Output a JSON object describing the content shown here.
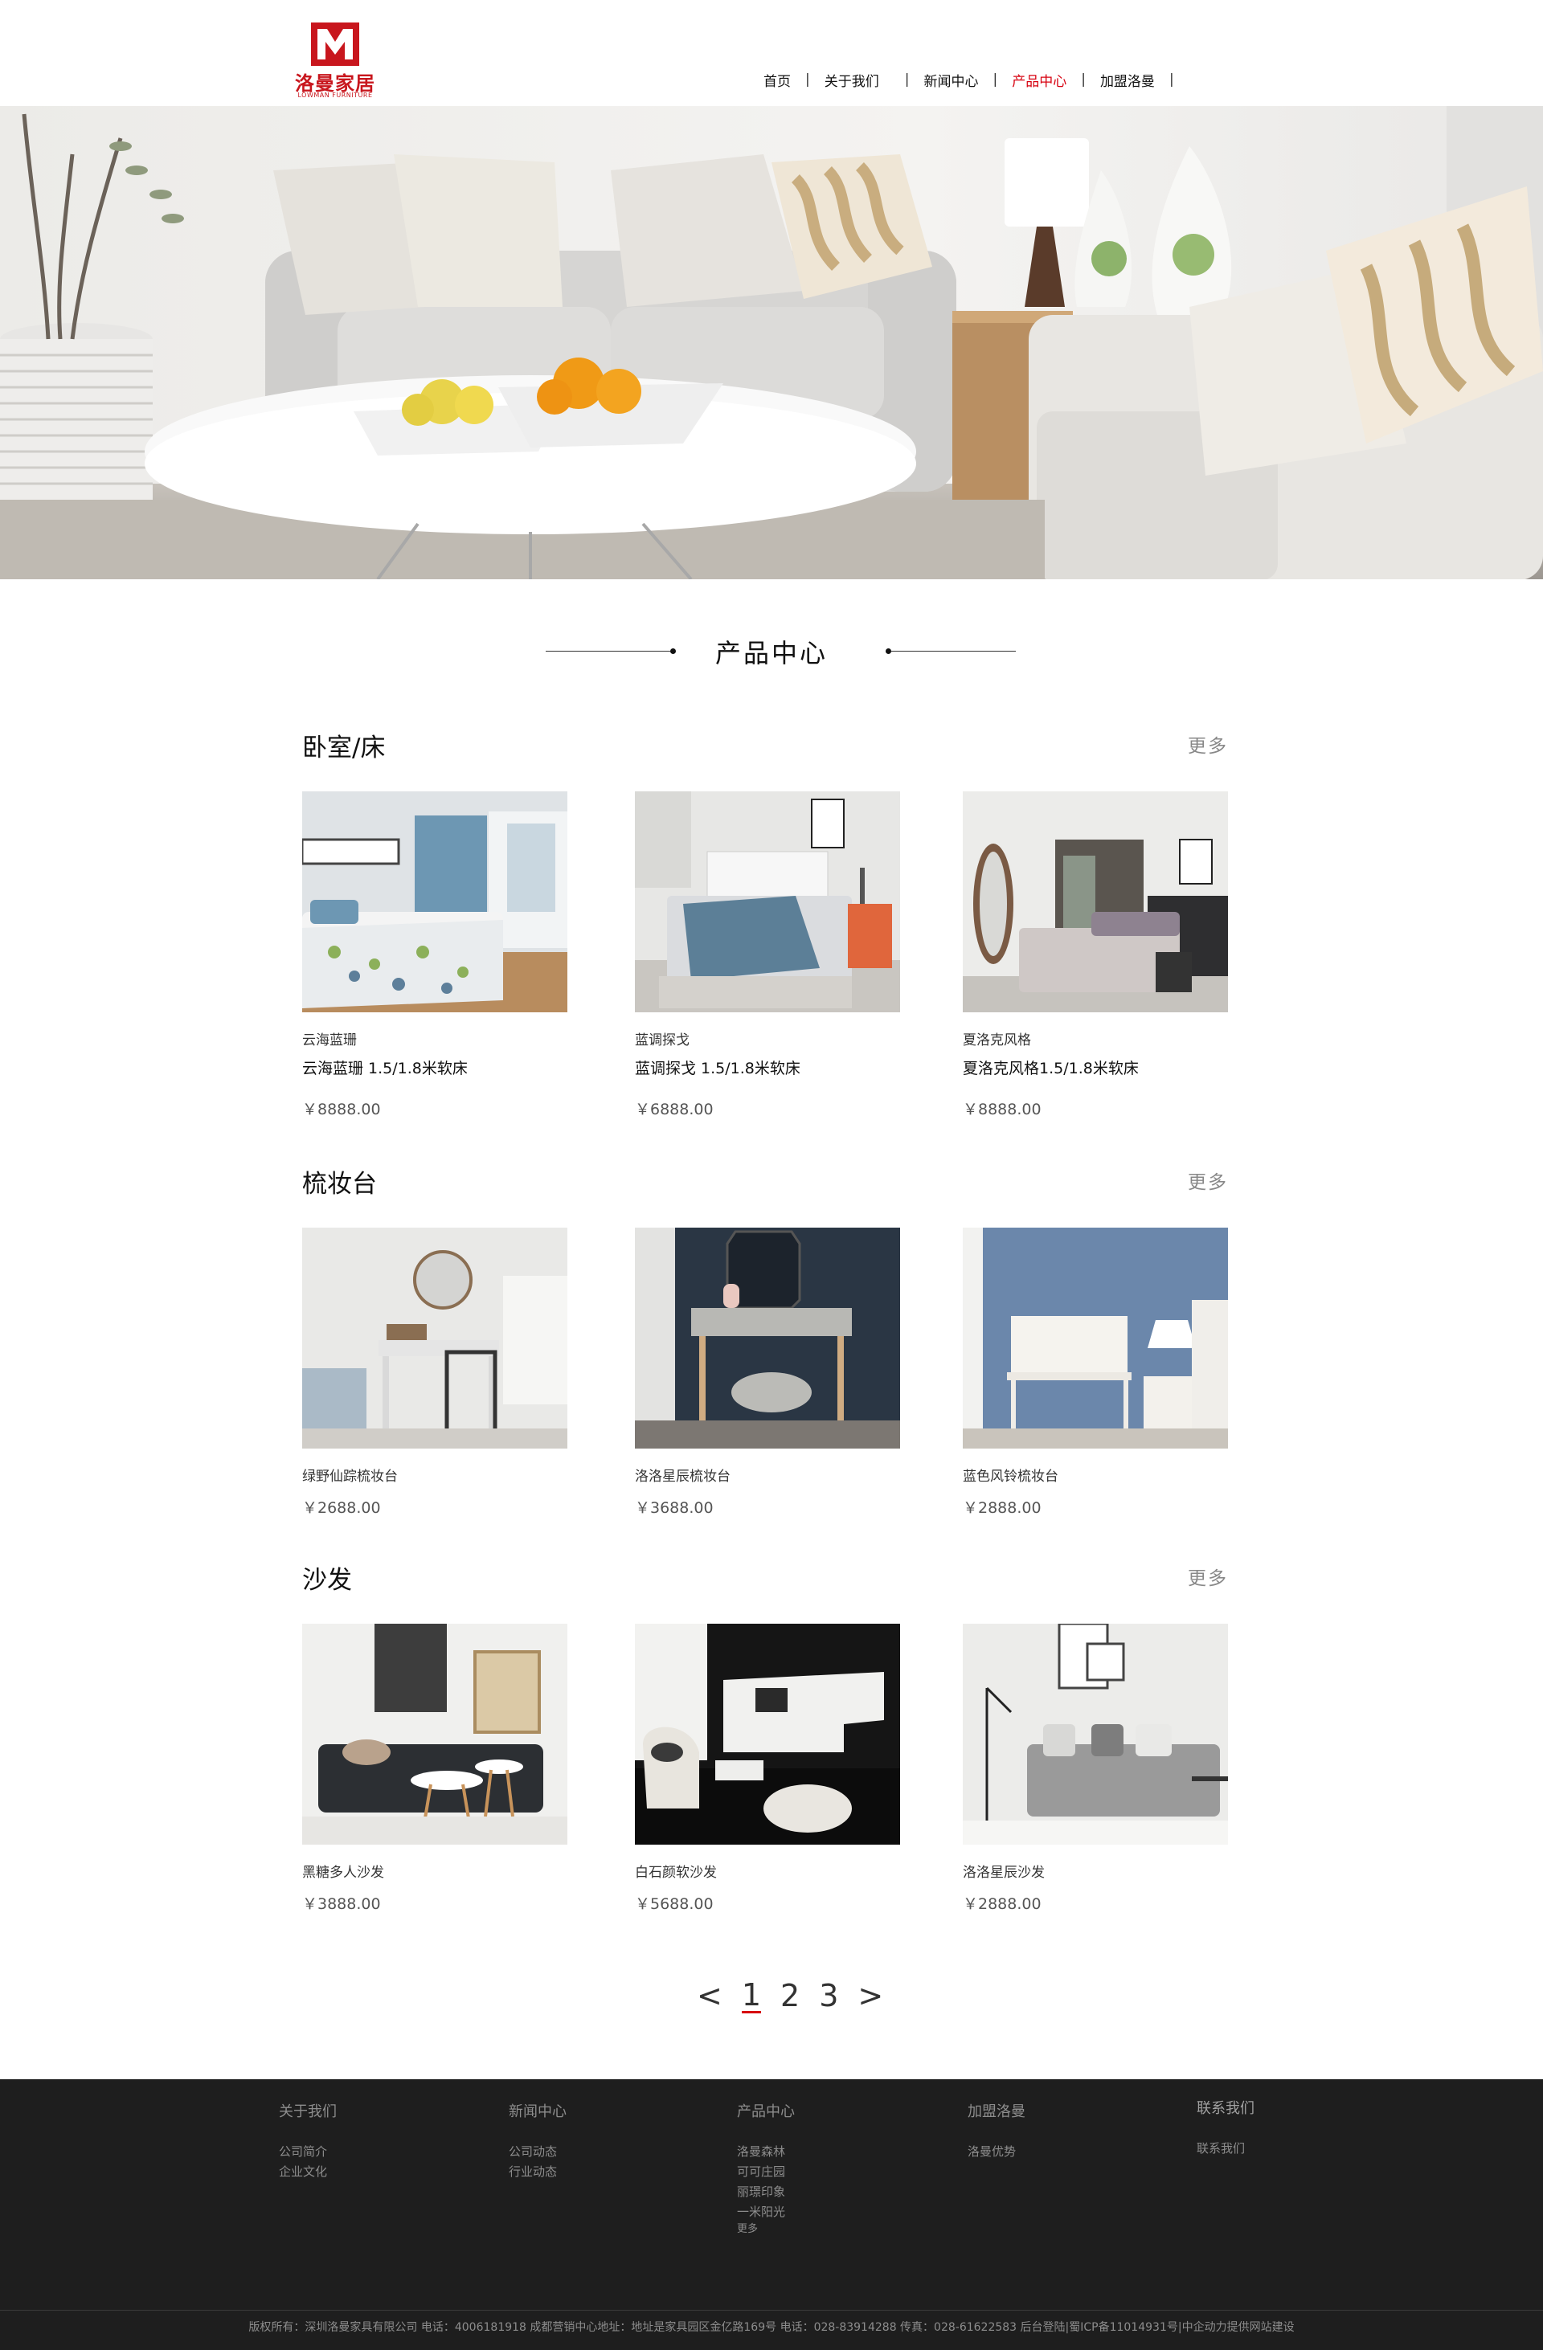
{
  "brand": {
    "name_cn": "洛曼家居",
    "name_en": "LOWMAN FURNITURE",
    "color": "#c8161d"
  },
  "nav": {
    "items": [
      {
        "label": "首页",
        "active": false
      },
      {
        "label": "关于我们",
        "active": false
      },
      {
        "label": "新闻中心",
        "active": false
      },
      {
        "label": "产品中心",
        "active": true
      },
      {
        "label": "加盟洛曼",
        "active": false
      }
    ],
    "active_color": "#d7000f"
  },
  "section": {
    "title": "产品中心"
  },
  "categories": [
    {
      "title": "卧室/床",
      "more": "更多",
      "products": [
        {
          "category": "云海蓝珊",
          "name": "云海蓝珊 1.5/1.8米软床",
          "price": "￥8888.00"
        },
        {
          "category": "蓝调探戈",
          "name": "蓝调探戈 1.5/1.8米软床",
          "price": "￥6888.00"
        },
        {
          "category": "夏洛克风格",
          "name": "夏洛克风格1.5/1.8米软床",
          "price": "￥8888.00"
        }
      ]
    },
    {
      "title": "梳妆台",
      "more": "更多",
      "products": [
        {
          "category": "绿野仙踪梳妆台",
          "price": "￥2688.00"
        },
        {
          "category": "洛洛星辰梳妆台",
          "price": "￥3688.00"
        },
        {
          "category": "蓝色风铃梳妆台",
          "price": "￥2888.00"
        }
      ]
    },
    {
      "title": "沙发",
      "more": "更多",
      "products": [
        {
          "category": "黑糖多人沙发",
          "price": "￥3888.00"
        },
        {
          "category": "白石颜软沙发",
          "price": "￥5688.00"
        },
        {
          "category": "洛洛星辰沙发",
          "price": "￥2888.00"
        }
      ]
    }
  ],
  "pagination": {
    "prev": "<",
    "pages": [
      "1",
      "2",
      "3"
    ],
    "current": "1",
    "next": ">"
  },
  "footer": {
    "columns": [
      {
        "title": "关于我们",
        "links": [
          "公司简介",
          "企业文化"
        ]
      },
      {
        "title": "新闻中心",
        "links": [
          "公司动态",
          "行业动态"
        ]
      },
      {
        "title": "产品中心",
        "links": [
          "洛曼森林",
          "可可庄园",
          "丽璟印象",
          "一米阳光"
        ],
        "extra": "更多"
      },
      {
        "title": "加盟洛曼",
        "links": [
          "洛曼优势"
        ]
      },
      {
        "title": "联系我们",
        "links": [
          "联系我们"
        ]
      }
    ],
    "copyright": "版权所有：深圳洛曼家具有限公司 电话：4006181918 成都营销中心地址：地址是家具园区金亿路169号 电话：028-83914288 传真：028-61622583 后台登陆|蜀ICP备11014931号|中企动力提供网站建设"
  }
}
